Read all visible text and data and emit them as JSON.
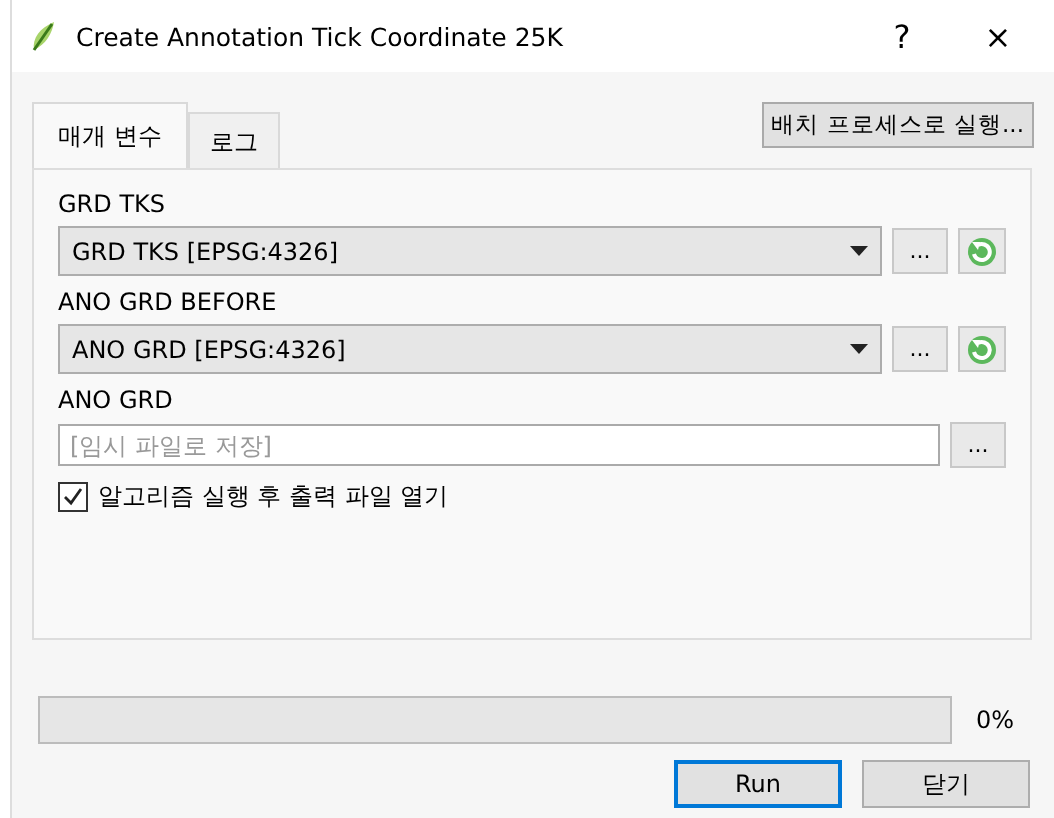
{
  "window": {
    "title": "Create Annotation Tick Coordinate 25K",
    "help": "?",
    "close": "×"
  },
  "tabs": [
    {
      "label": "매개 변수",
      "selected": true
    },
    {
      "label": "로그",
      "selected": false
    }
  ],
  "batch_button": "배치 프로세스로 실행...",
  "parameters": [
    {
      "kind": "combo",
      "label": "GRD TKS",
      "value": "GRD TKS [EPSG:4326]",
      "browse": "..."
    },
    {
      "kind": "combo",
      "label": "ANO GRD BEFORE",
      "value": "ANO GRD [EPSG:4326]",
      "browse": "..."
    },
    {
      "kind": "file",
      "label": "ANO GRD",
      "placeholder": "[임시 파일로 저장]",
      "browse": "..."
    }
  ],
  "open_output": {
    "label": "알고리즘 실행 후 출력 파일 열기",
    "checked": true
  },
  "progress": {
    "level": 0,
    "reading": "0%"
  },
  "buttons": [
    {
      "label": "Run",
      "selected": true
    },
    {
      "label": "닫기",
      "selected": false
    }
  ]
}
